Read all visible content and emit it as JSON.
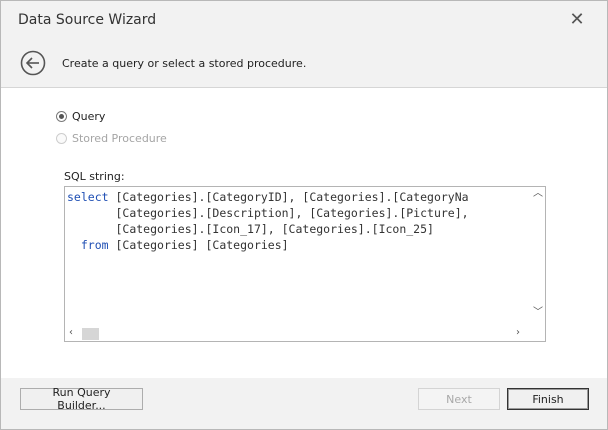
{
  "window": {
    "title": "Data Source Wizard"
  },
  "header": {
    "text": "Create a query or select a stored procedure."
  },
  "options": {
    "query_label": "Query",
    "stored_procedure_label": "Stored Procedure",
    "selected": "Query"
  },
  "sql": {
    "label": "SQL string:",
    "lines": [
      {
        "kw": "select",
        "indent": "",
        "rest": " [Categories].[CategoryID], [Categories].[CategoryNa"
      },
      {
        "kw": "",
        "indent": "       ",
        "rest": "[Categories].[Description], [Categories].[Picture],"
      },
      {
        "kw": "",
        "indent": "       ",
        "rest": "[Categories].[Icon_17], [Categories].[Icon_25]"
      },
      {
        "kw": "from",
        "indent": "  ",
        "rest": " [Categories] [Categories]"
      }
    ]
  },
  "footer": {
    "run_query_builder_label": "Run Query Builder...",
    "next_label": "Next",
    "finish_label": "Finish"
  },
  "colors": {
    "keyword": "#1f4fb4",
    "background": "#f2f2f2"
  },
  "icons": {
    "close": "close-icon",
    "back": "back-arrow-icon"
  }
}
